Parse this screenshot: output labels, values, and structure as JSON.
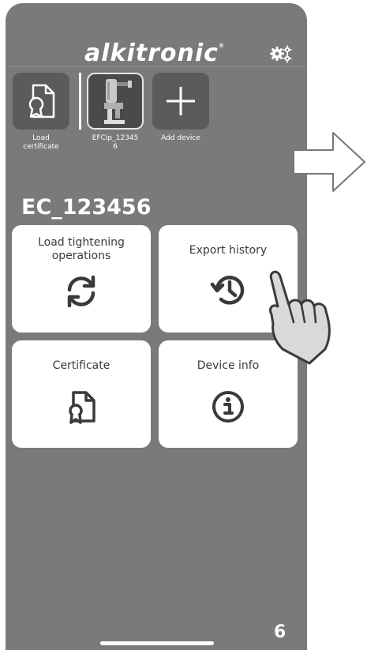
{
  "app": {
    "logo": "alkitronic",
    "logo_mark": "®"
  },
  "header": {
    "settings_icon": "gears-icon"
  },
  "devices": [
    {
      "label": "Load certificate",
      "icon": "certificate-icon"
    },
    {
      "label": "EFCip_123456",
      "icon": "tool-photo",
      "selected": true
    },
    {
      "label": "Add device",
      "icon": "plus-icon"
    }
  ],
  "device_labels": {
    "load_l1": "Load",
    "load_l2": "certificate",
    "efc_l1": "EFCip_12345",
    "efc_l2": "6",
    "add": "Add device"
  },
  "page_title": "EC_123456",
  "cards": {
    "load_tightening_l1": "Load tightening",
    "load_tightening_l2": "operations",
    "export_history": "Export history",
    "certificate": "Certificate",
    "device_info": "Device info"
  },
  "step_number": "6",
  "colors": {
    "background": "#7a7a7a",
    "card": "#ffffff",
    "text_dark": "#3a3a3a"
  }
}
